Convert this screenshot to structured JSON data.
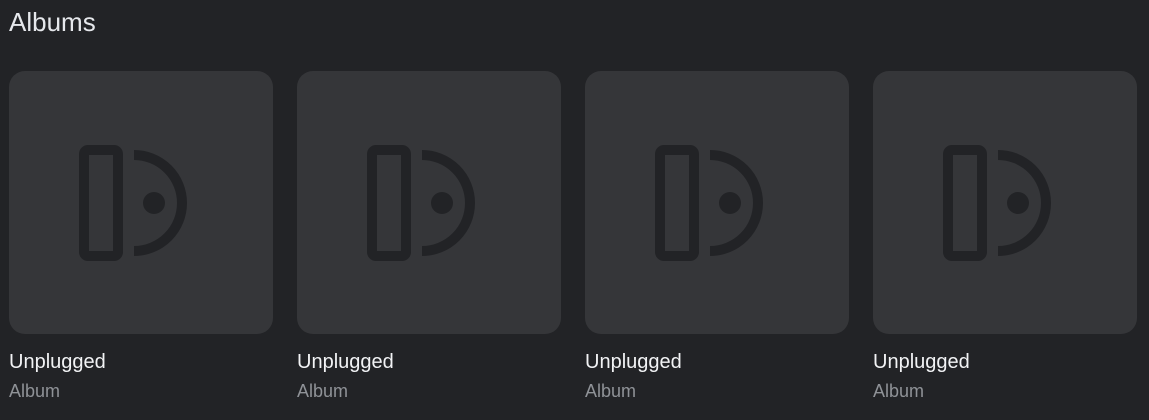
{
  "section": {
    "title": "Albums"
  },
  "albums": [
    {
      "title": "Unplugged",
      "subtitle": "Album",
      "icon": "album-placeholder-icon"
    },
    {
      "title": "Unplugged",
      "subtitle": "Album",
      "icon": "album-placeholder-icon"
    },
    {
      "title": "Unplugged",
      "subtitle": "Album",
      "icon": "album-placeholder-icon"
    },
    {
      "title": "Unplugged",
      "subtitle": "Album",
      "icon": "album-placeholder-icon"
    }
  ],
  "colors": {
    "background": "#222326",
    "cover": "#353639",
    "icon": "#222326",
    "title": "#f2f3f5",
    "subtitle": "#8f9297"
  }
}
